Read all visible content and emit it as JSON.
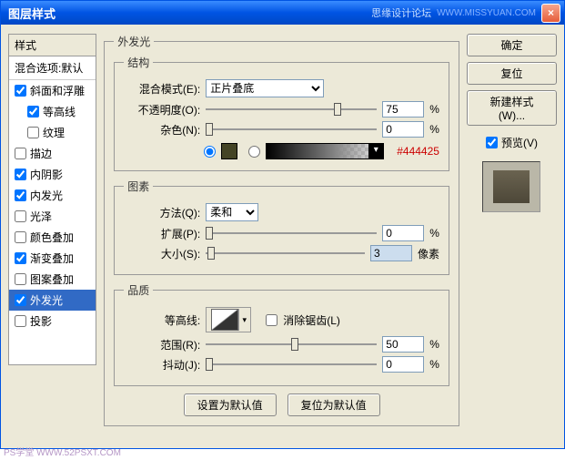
{
  "window": {
    "title": "图层样式",
    "forum": "思缘设计论坛",
    "url": "WWW.MISSYUAN.COM",
    "close": "×"
  },
  "left": {
    "header": "样式",
    "blend_row": "混合选项:默认",
    "items": [
      {
        "label": "斜面和浮雕",
        "checked": true,
        "indent": false
      },
      {
        "label": "等高线",
        "checked": true,
        "indent": true
      },
      {
        "label": "纹理",
        "checked": false,
        "indent": true
      },
      {
        "label": "描边",
        "checked": false,
        "indent": false
      },
      {
        "label": "内阴影",
        "checked": true,
        "indent": false
      },
      {
        "label": "内发光",
        "checked": true,
        "indent": false
      },
      {
        "label": "光泽",
        "checked": false,
        "indent": false
      },
      {
        "label": "颜色叠加",
        "checked": false,
        "indent": false
      },
      {
        "label": "渐变叠加",
        "checked": true,
        "indent": false
      },
      {
        "label": "图案叠加",
        "checked": false,
        "indent": false
      },
      {
        "label": "外发光",
        "checked": true,
        "indent": false,
        "selected": true
      },
      {
        "label": "投影",
        "checked": false,
        "indent": false
      }
    ]
  },
  "mid": {
    "group_title": "外发光",
    "structure": {
      "legend": "结构",
      "blend_label": "混合模式(E):",
      "blend_value": "正片叠底",
      "opacity_label": "不透明度(O):",
      "opacity_value": "75",
      "opacity_unit": "%",
      "noise_label": "杂色(N):",
      "noise_value": "0",
      "noise_unit": "%",
      "hex": "#444425"
    },
    "elements": {
      "legend": "图素",
      "method_label": "方法(Q):",
      "method_value": "柔和",
      "spread_label": "扩展(P):",
      "spread_value": "0",
      "spread_unit": "%",
      "size_label": "大小(S):",
      "size_value": "3",
      "size_unit": "像素"
    },
    "quality": {
      "legend": "品质",
      "contour_label": "等高线:",
      "anti_label": "消除锯齿(L)",
      "range_label": "范围(R):",
      "range_value": "50",
      "range_unit": "%",
      "jitter_label": "抖动(J):",
      "jitter_value": "0",
      "jitter_unit": "%"
    },
    "default_btn": "设置为默认值",
    "reset_btn": "复位为默认值"
  },
  "right": {
    "ok": "确定",
    "cancel": "复位",
    "new_style": "新建样式(W)...",
    "preview_label": "预览(V)",
    "preview_checked": true
  },
  "watermark": "PS学堂  WWW.52PSXT.COM"
}
